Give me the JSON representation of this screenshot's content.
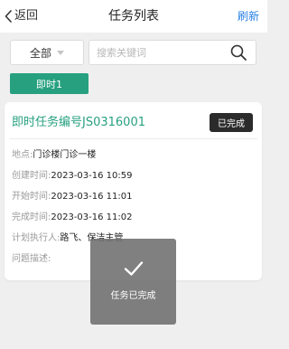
{
  "navbar": {
    "back_label": "返回",
    "title": "任务列表",
    "refresh_label": "刷新"
  },
  "filter": {
    "selected": "全部"
  },
  "search": {
    "placeholder": "搜索关键词",
    "value": ""
  },
  "tabs": [
    {
      "label": "即时1"
    }
  ],
  "task": {
    "title": "即时任务编号JS0316001",
    "status": "已完成",
    "fields": [
      {
        "label": "地点:",
        "value": "门诊楼门诊一楼"
      },
      {
        "label": "创建时间:",
        "value": "2023-03-16 10:59"
      },
      {
        "label": "开始时间:",
        "value": "2023-03-16 11:01"
      },
      {
        "label": "完成时间:",
        "value": "2023-03-16 11:02"
      },
      {
        "label": "计划执行人:",
        "value": "路飞、保洁主管"
      },
      {
        "label": "问题描述:",
        "value": ""
      }
    ]
  },
  "toast": {
    "text": "任务已完成",
    "icon": "checkmark-icon"
  },
  "colors": {
    "accent": "#27a080",
    "link": "#2a82e4",
    "badge_bg": "#2b2b2b",
    "background": "#efefef"
  }
}
